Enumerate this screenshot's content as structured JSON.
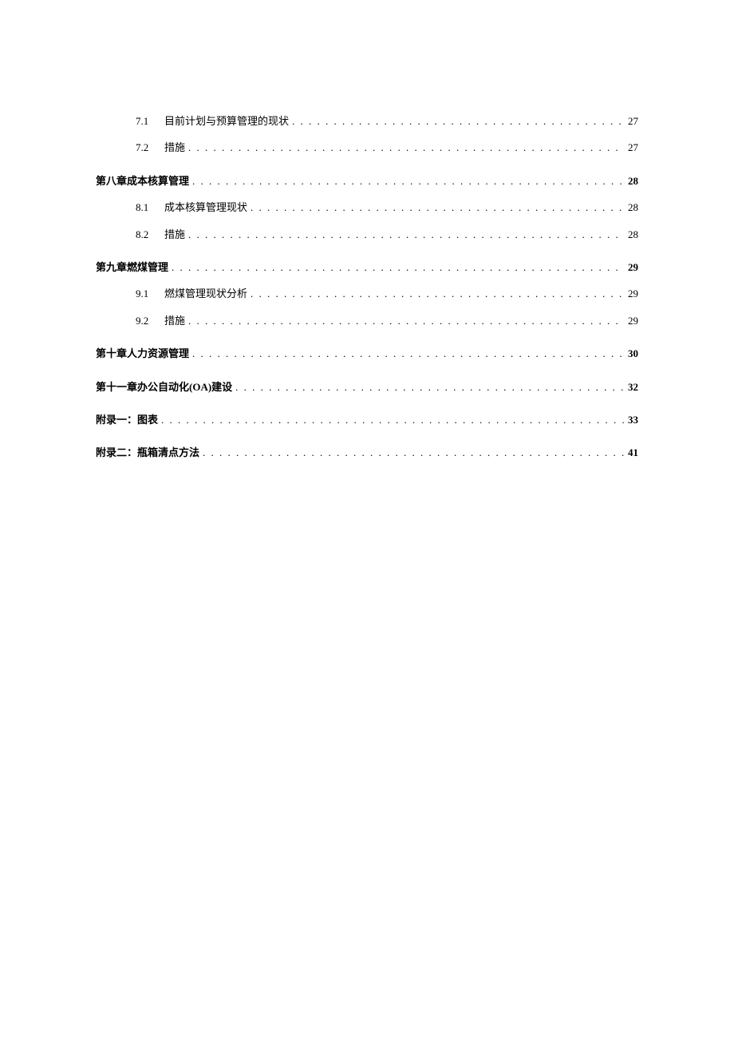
{
  "toc": [
    {
      "level": 2,
      "number": "7.1",
      "title": "目前计划与预算管理的现状",
      "page": "27"
    },
    {
      "level": 2,
      "number": "7.2",
      "title": "措施",
      "page": "27"
    },
    {
      "level": 1,
      "number": "",
      "title": "第八章成本核算管理",
      "page": "28"
    },
    {
      "level": 2,
      "number": "8.1",
      "title": "成本核算管理现状",
      "page": "28"
    },
    {
      "level": 2,
      "number": "8.2",
      "title": "措施",
      "page": "28"
    },
    {
      "level": 1,
      "number": "",
      "title": "第九章燃煤管理",
      "page": "29"
    },
    {
      "level": 2,
      "number": "9.1",
      "title": "燃煤管理现状分析",
      "page": "29"
    },
    {
      "level": 2,
      "number": "9.2",
      "title": "措施",
      "page": "29"
    },
    {
      "level": 1,
      "number": "",
      "title": "第十章人力资源管理",
      "page": "30"
    },
    {
      "level": 1,
      "number": "",
      "title": "第十一章办公自动化(OA)建设",
      "page": "32"
    },
    {
      "level": 1,
      "number": "",
      "title": "附录一：图表",
      "page": "33"
    },
    {
      "level": 1,
      "number": "",
      "title": "附录二：瓶箱清点方法",
      "page": "41"
    }
  ]
}
